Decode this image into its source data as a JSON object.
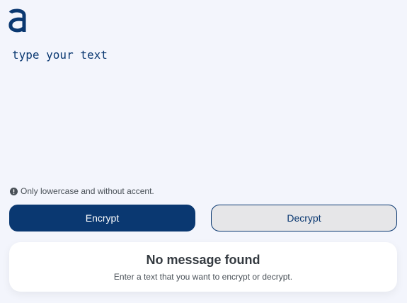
{
  "logo": {
    "icon": "alura-logo-icon",
    "color": "#0a3871"
  },
  "input": {
    "placeholder": "type your text",
    "value": ""
  },
  "hint": {
    "icon": "exclamation-circle-icon",
    "text": "Only lowercase and without accent."
  },
  "buttons": {
    "encrypt_label": "Encrypt",
    "decrypt_label": "Decrypt"
  },
  "result": {
    "title": "No message found",
    "subtitle": "Enter a text that you want to encrypt or decrypt."
  },
  "colors": {
    "background": "#f3f5fc",
    "primary": "#0a3871",
    "secondary_button_bg": "#e6e6e8",
    "card_bg": "#ffffff"
  }
}
